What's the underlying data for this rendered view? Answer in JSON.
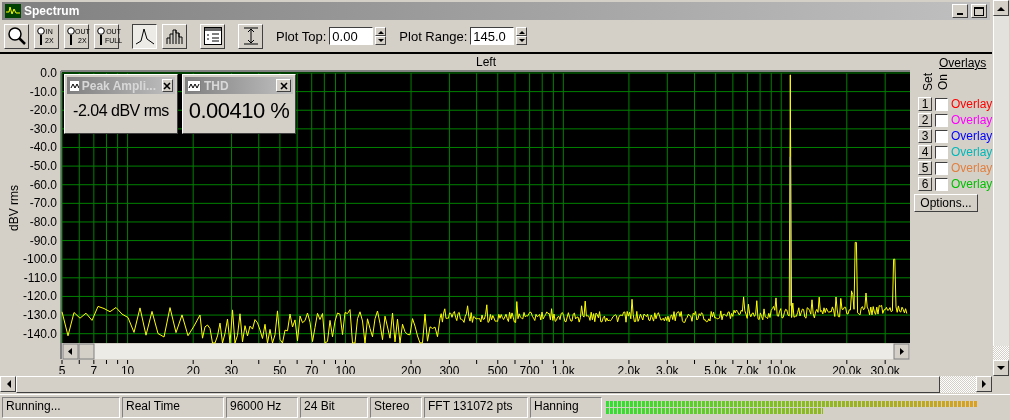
{
  "window": {
    "title": "Spectrum"
  },
  "toolbar": {
    "buttons": [
      {
        "kind": "magnifier"
      },
      {
        "kind": "zoom",
        "top": "IN",
        "bottom": "2X"
      },
      {
        "kind": "zoom",
        "top": "OUT",
        "bottom": "2X"
      },
      {
        "kind": "zoom",
        "top": "OUT",
        "bottom": "FULL"
      },
      {
        "kind": "line",
        "selected": true
      },
      {
        "kind": "bars",
        "selected": false
      },
      {
        "kind": "panel"
      },
      {
        "kind": "range"
      }
    ],
    "fields": [
      {
        "label": "Plot Top:",
        "value": "0.00"
      },
      {
        "label": "Plot Range:",
        "value": "145.0"
      }
    ]
  },
  "chart": {
    "channel": "Left",
    "ylabel": "dBV rms",
    "yticks": [
      "0.0",
      "-10.0",
      "-20.0",
      "-30.0",
      "-40.0",
      "-50.0",
      "-60.0",
      "-70.0",
      "-80.0",
      "-90.0",
      "-100.0",
      "-110.0",
      "-120.0",
      "-130.0",
      "-140.0"
    ],
    "xticks": [
      "5",
      "7",
      "10",
      "20",
      "30",
      "50",
      "70",
      "100",
      "200",
      "300",
      "500",
      "700",
      "1.0k",
      "2.0k",
      "3.0k",
      "5.0k",
      "7.0k",
      "10.0k",
      "20.0k",
      "30.0k"
    ]
  },
  "readouts": [
    {
      "title": "Peak Ampli...",
      "value": "-2.04 dBV rms"
    },
    {
      "title": "THD",
      "value": "0.00410 %"
    }
  ],
  "overlays": {
    "title": "Overlays",
    "set_label": "Set",
    "on_label": "On",
    "options_button": "Options...",
    "rows": [
      {
        "set": "1",
        "checked": false,
        "label": "Overlay",
        "color": "#ff0000"
      },
      {
        "set": "2",
        "checked": false,
        "label": "Overlay",
        "color": "#ff00ff"
      },
      {
        "set": "3",
        "checked": false,
        "label": "Overlay",
        "color": "#0000ff"
      },
      {
        "set": "4",
        "checked": false,
        "label": "Overlay",
        "color": "#00b8b8"
      },
      {
        "set": "5",
        "checked": false,
        "label": "Overlay",
        "color": "#e08040"
      },
      {
        "set": "6",
        "checked": false,
        "label": "Overlay",
        "color": "#00c000"
      }
    ]
  },
  "status_bar": {
    "fields": [
      "Running...",
      "Real Time",
      "96000 Hz",
      "24 Bit",
      "Stereo",
      "FFT 131072 pts",
      "Hanning"
    ],
    "meters": [
      {
        "level": 0.98
      },
      {
        "level": 0.57
      }
    ]
  }
}
